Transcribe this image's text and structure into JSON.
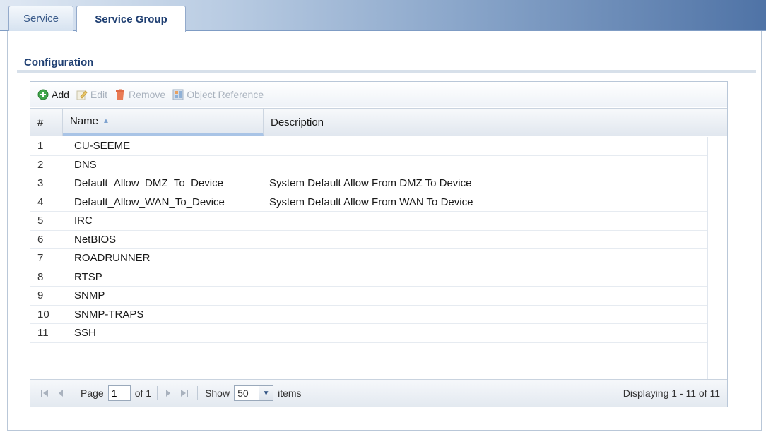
{
  "tabs": [
    {
      "label": "Service"
    },
    {
      "label": "Service Group"
    }
  ],
  "section": {
    "title": "Configuration"
  },
  "toolbar": {
    "add": "Add",
    "edit": "Edit",
    "remove": "Remove",
    "object_reference": "Object Reference"
  },
  "table": {
    "columns": {
      "num": "#",
      "name": "Name",
      "description": "Description"
    },
    "sort_indicator": "▲",
    "rows": [
      {
        "num": "1",
        "name": "CU-SEEME",
        "description": ""
      },
      {
        "num": "2",
        "name": "DNS",
        "description": ""
      },
      {
        "num": "3",
        "name": "Default_Allow_DMZ_To_Device",
        "description": "System Default Allow From DMZ To Device"
      },
      {
        "num": "4",
        "name": "Default_Allow_WAN_To_Device",
        "description": "System Default Allow From WAN To Device"
      },
      {
        "num": "5",
        "name": "IRC",
        "description": ""
      },
      {
        "num": "6",
        "name": "NetBIOS",
        "description": ""
      },
      {
        "num": "7",
        "name": "ROADRUNNER",
        "description": ""
      },
      {
        "num": "8",
        "name": "RTSP",
        "description": ""
      },
      {
        "num": "9",
        "name": "SNMP",
        "description": ""
      },
      {
        "num": "10",
        "name": "SNMP-TRAPS",
        "description": ""
      },
      {
        "num": "11",
        "name": "SSH",
        "description": ""
      }
    ]
  },
  "pager": {
    "page_label": "Page",
    "page_value": "1",
    "of_label": "of 1",
    "show_label": "Show",
    "show_value": "50",
    "items_label": "items",
    "display_text": "Displaying 1 - 11 of 11"
  },
  "colors": {
    "tab_active_text": "#1f3f72",
    "add_icon": "#3fa54a",
    "remove_icon": "#d9532c"
  }
}
